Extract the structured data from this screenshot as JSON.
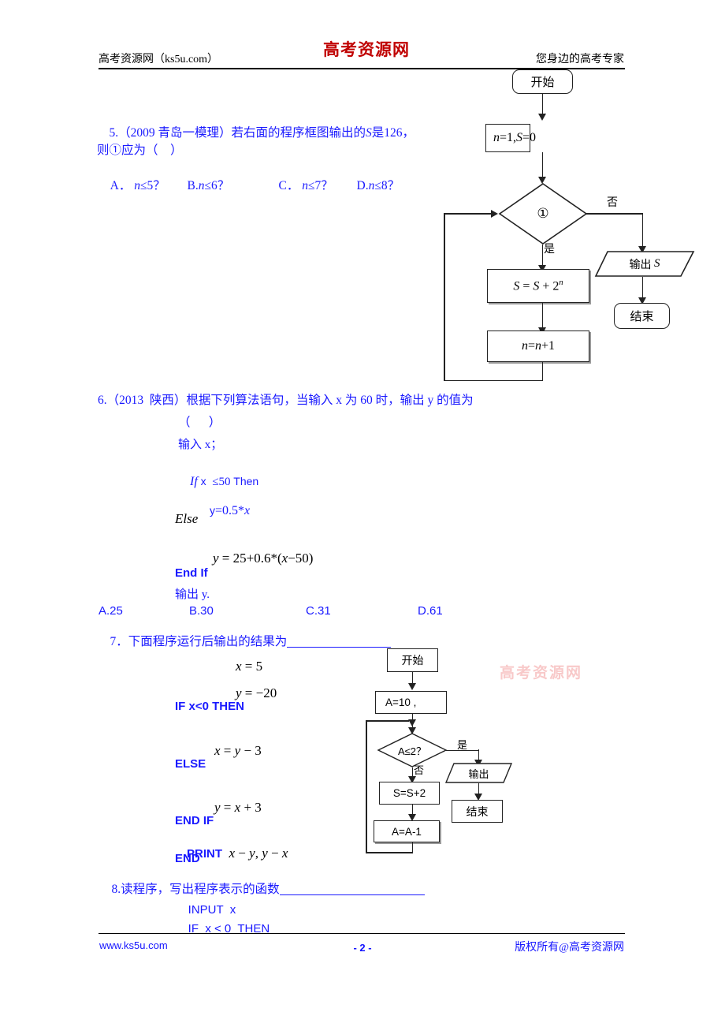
{
  "header": {
    "logo": "高考资源网",
    "left": "高考资源网（ks5u.com）",
    "right": "您身边的高考专家"
  },
  "footer": {
    "left": "www.ks5u.com",
    "page_number": "- 2 -",
    "right": "版权所有@高考资源网"
  },
  "watermark": "高考资源网",
  "q5": {
    "line1": "5.（2009 青岛一模理）若右面的程序框图输出的",
    "line1_var": "S",
    "line1_tail": "是126，",
    "line2": "则①应为（    ）",
    "choices": [
      {
        "label": "A．",
        "var": "n",
        "rel": "≤5？"
      },
      {
        "label": "B.",
        "var": "n",
        "rel": "≤6？"
      },
      {
        "label": "C．",
        "var": "n",
        "rel": "≤7？"
      },
      {
        "label": "D.",
        "var": "n",
        "rel": "≤8？"
      }
    ],
    "flowchart": {
      "type": "flowchart",
      "nodes": [
        {
          "id": "start",
          "shape": "terminator",
          "text": "开始"
        },
        {
          "id": "init",
          "shape": "process",
          "text": "n=1,S=0"
        },
        {
          "id": "cond",
          "shape": "decision",
          "text": "①"
        },
        {
          "id": "accum",
          "shape": "process",
          "text": "S = S + 2ⁿ"
        },
        {
          "id": "incr",
          "shape": "process",
          "text": "n=n+1"
        },
        {
          "id": "output",
          "shape": "io",
          "text": "输出 S"
        },
        {
          "id": "end",
          "shape": "terminator",
          "text": "结束"
        }
      ],
      "edges": [
        {
          "from": "start",
          "to": "init",
          "label": ""
        },
        {
          "from": "init",
          "to": "cond",
          "label": ""
        },
        {
          "from": "cond",
          "to": "accum",
          "label": "是"
        },
        {
          "from": "cond",
          "to": "output",
          "label": "否"
        },
        {
          "from": "accum",
          "to": "incr",
          "label": ""
        },
        {
          "from": "incr",
          "to": "cond",
          "label": ""
        },
        {
          "from": "output",
          "to": "end",
          "label": ""
        }
      ],
      "labels": {
        "yes": "是",
        "no": "否"
      }
    }
  },
  "q6": {
    "line1": "6.（2013  陕西）根据下列算法语句，当输入 x 为 60 时，输出 y 的值为",
    "line2": "（      ）",
    "code": [
      {
        "text": "输入 x；",
        "color": "blue",
        "style": "cn"
      },
      {
        "text": "If x  ≤50 Then",
        "color": "blue",
        "style": "kw"
      },
      {
        "text": "y=0.5*x",
        "color": "blue",
        "style": "math"
      },
      {
        "text": "Else",
        "color": "black",
        "style": "kw"
      },
      {
        "text": "y = 25+0.6*(x−50)",
        "color": "black",
        "style": "math"
      },
      {
        "text": "End If",
        "color": "blue",
        "style": "kw"
      },
      {
        "text": "输出 y.",
        "color": "blue",
        "style": "cn"
      }
    ],
    "choices": [
      "A.25",
      "B.30",
      "C.31",
      "D.61"
    ]
  },
  "q7": {
    "line1": "7．下面程序运行后输出的结果为",
    "code": [
      {
        "text": "x = 5",
        "color": "black",
        "style": "math"
      },
      {
        "text": "y = −20",
        "color": "black",
        "style": "math"
      },
      {
        "text": "IF x<0 THEN",
        "color": "blue",
        "style": "kw"
      },
      {
        "text": "x = y − 3",
        "color": "black",
        "style": "math"
      },
      {
        "text": "ELSE",
        "color": "blue",
        "style": "kw"
      },
      {
        "text": "y = x + 3",
        "color": "black",
        "style": "math"
      },
      {
        "text": "END IF",
        "color": "blue",
        "style": "kw"
      },
      {
        "text": "PRINT",
        "color": "blue",
        "style": "kw"
      },
      {
        "text": "x − y, y − x",
        "color": "black",
        "style": "math"
      },
      {
        "text": "END",
        "color": "blue",
        "style": "kw"
      }
    ],
    "flowchart": {
      "type": "flowchart",
      "nodes": [
        {
          "id": "start",
          "shape": "process",
          "text": "开始"
        },
        {
          "id": "init",
          "shape": "process",
          "text": "A=10   ,"
        },
        {
          "id": "cond",
          "shape": "decision",
          "text": "A≤2？"
        },
        {
          "id": "accum",
          "shape": "process",
          "text": "S=S+2"
        },
        {
          "id": "decr",
          "shape": "process",
          "text": "A=A-1"
        },
        {
          "id": "output",
          "shape": "io",
          "text": "输出"
        },
        {
          "id": "end",
          "shape": "process",
          "text": "结束"
        }
      ],
      "edges": [
        {
          "from": "start",
          "to": "init",
          "label": ""
        },
        {
          "from": "init",
          "to": "cond",
          "label": ""
        },
        {
          "from": "cond",
          "to": "output",
          "label": "是"
        },
        {
          "from": "cond",
          "to": "accum",
          "label": "否"
        },
        {
          "from": "accum",
          "to": "decr",
          "label": ""
        },
        {
          "from": "decr",
          "to": "cond",
          "label": ""
        },
        {
          "from": "output",
          "to": "end",
          "label": ""
        }
      ],
      "labels": {
        "yes": "是",
        "no": "否"
      }
    }
  },
  "q8": {
    "line1": "8.读程序，写出程序表示的函数",
    "code": [
      {
        "text": "INPUT  x",
        "color": "blue",
        "style": "kw"
      },
      {
        "text": "IF  x < 0  THEN",
        "color": "blue",
        "style": "kw"
      }
    ]
  }
}
